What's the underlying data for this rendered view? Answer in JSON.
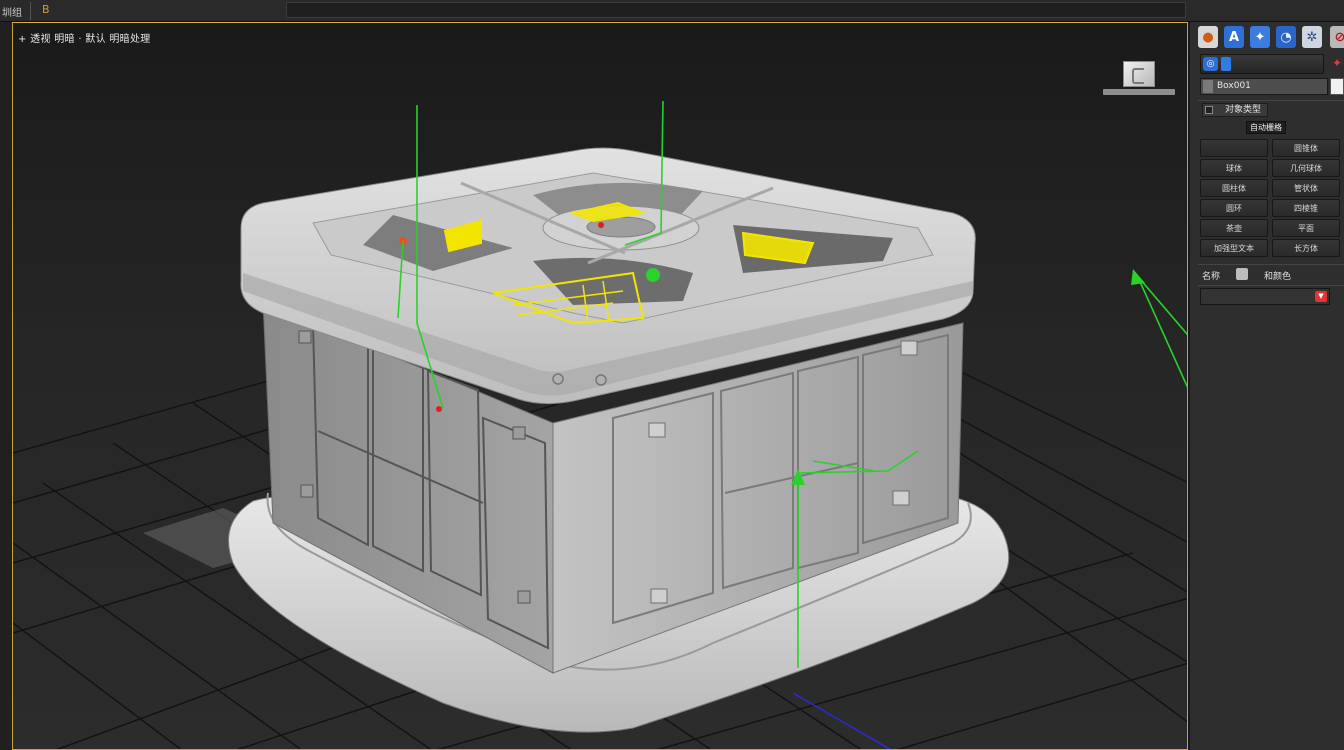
{
  "menubar": {
    "left_label": "圳组",
    "accent_label": "B"
  },
  "viewport": {
    "label": "+ 透视 明暗 ·  默认 明暗处理"
  },
  "panel": {
    "tabs": [
      {
        "name": "create-tab",
        "glyph": "●"
      },
      {
        "name": "modify-tab",
        "glyph": "A"
      },
      {
        "name": "hierarchy-tab",
        "glyph": "✦"
      },
      {
        "name": "motion-tab",
        "glyph": "◔"
      },
      {
        "name": "display-tab",
        "glyph": "✲"
      },
      {
        "name": "utilities-tab",
        "glyph": "⊘"
      }
    ],
    "object_name": "Box001",
    "rollout_title": "对象类型",
    "autogrid_label": "自动栅格",
    "buttons": [
      {
        "label": "",
        "id": "b1"
      },
      {
        "label": "圆锥体",
        "id": "b2"
      },
      {
        "label": "球体",
        "id": "b3"
      },
      {
        "label": "几何球体",
        "id": "b4"
      },
      {
        "label": "圆柱体",
        "id": "b5"
      },
      {
        "label": "管状体",
        "id": "b6"
      },
      {
        "label": "圆环",
        "id": "b7"
      },
      {
        "label": "四棱锥",
        "id": "b8"
      },
      {
        "label": "茶壶",
        "id": "b9"
      },
      {
        "label": "平面",
        "id": "b10"
      },
      {
        "label": "加强型文本",
        "id": "b11"
      },
      {
        "label": "长方体",
        "id": "b12"
      }
    ],
    "rollout2_label_a": "名称",
    "rollout2_label_b": "和颜色"
  },
  "colors": {
    "viewport_border": "#c9a23a",
    "gizmo_green": "#2bd12b",
    "selection_yellow": "#f2e600",
    "axis_red": "#e02020",
    "axis_blue": "#2a2ad6"
  }
}
